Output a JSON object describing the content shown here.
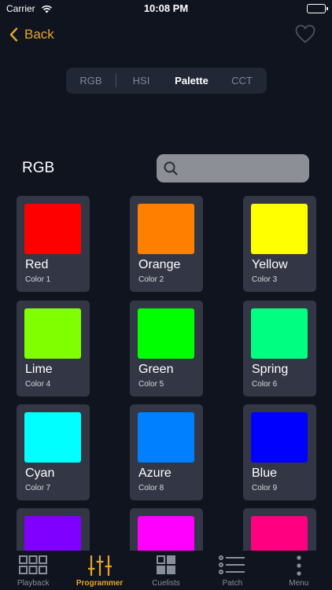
{
  "status_bar": {
    "carrier": "Carrier",
    "time": "10:08 PM"
  },
  "nav": {
    "back_label": "Back"
  },
  "segments": [
    {
      "label": "RGB",
      "active": false
    },
    {
      "label": "HSI",
      "active": false
    },
    {
      "label": "Palette",
      "active": true
    },
    {
      "label": "CCT",
      "active": false
    }
  ],
  "section": {
    "title": "RGB",
    "search_placeholder": ""
  },
  "colors": [
    {
      "name": "Red",
      "sub": "Color 1",
      "hex": "#ff0000"
    },
    {
      "name": "Orange",
      "sub": "Color 2",
      "hex": "#ff8000"
    },
    {
      "name": "Yellow",
      "sub": "Color 3",
      "hex": "#ffff00"
    },
    {
      "name": "Lime",
      "sub": "Color 4",
      "hex": "#80ff00"
    },
    {
      "name": "Green",
      "sub": "Color 5",
      "hex": "#00ff00"
    },
    {
      "name": "Spring",
      "sub": "Color 6",
      "hex": "#00ff80"
    },
    {
      "name": "Cyan",
      "sub": "Color 7",
      "hex": "#00ffff"
    },
    {
      "name": "Azure",
      "sub": "Color 8",
      "hex": "#0080ff"
    },
    {
      "name": "Blue",
      "sub": "Color 9",
      "hex": "#0000ff"
    },
    {
      "name": "",
      "sub": "",
      "hex": "#8000ff"
    },
    {
      "name": "",
      "sub": "",
      "hex": "#ff00ff"
    },
    {
      "name": "",
      "sub": "",
      "hex": "#ff0080"
    }
  ],
  "tabs": [
    {
      "label": "Playback",
      "icon": "grid-icon",
      "active": false
    },
    {
      "label": "Programmer",
      "icon": "sliders-icon",
      "active": true
    },
    {
      "label": "Cuelists",
      "icon": "squares-icon",
      "active": false
    },
    {
      "label": "Patch",
      "icon": "list-icon",
      "active": false
    },
    {
      "label": "Menu",
      "icon": "more-icon",
      "active": false
    }
  ],
  "theme": {
    "accent": "#e6a52a",
    "background": "#10141f",
    "card": "#333745"
  }
}
